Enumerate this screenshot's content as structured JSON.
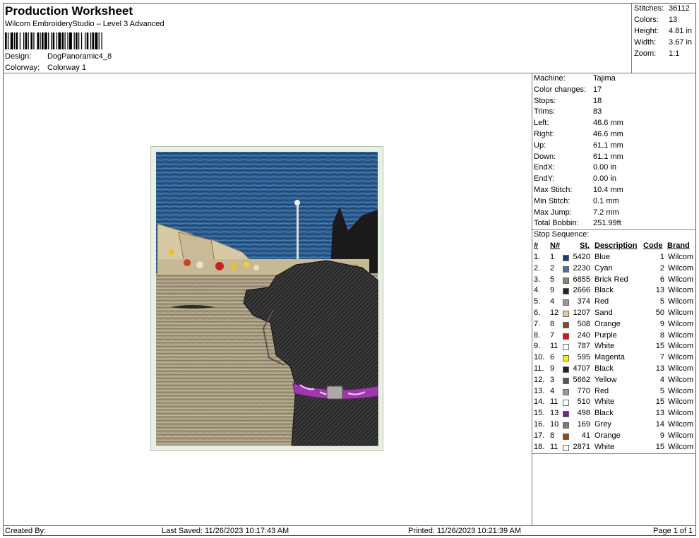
{
  "header": {
    "title": "Production Worksheet",
    "subtitle": "Wilcom EmbroideryStudio – Level 3 Advanced",
    "design_label": "Design:",
    "design_value": "DogPanoramic4_8",
    "colorway_label": "Colorway:",
    "colorway_value": "Colorway 1"
  },
  "stats": [
    {
      "label": "Stitches:",
      "value": "36112"
    },
    {
      "label": "Colors:",
      "value": "13"
    },
    {
      "label": "Height:",
      "value": "4.81 in"
    },
    {
      "label": "Width:",
      "value": "3.67 in"
    },
    {
      "label": "Zoom:",
      "value": "1:1"
    }
  ],
  "machine_info": [
    {
      "label": "Machine:",
      "value": "Tajima"
    },
    {
      "label": "Color changes:",
      "value": "17"
    },
    {
      "label": "Stops:",
      "value": "18"
    },
    {
      "label": "Trims:",
      "value": "83"
    },
    {
      "label": "Left:",
      "value": "46.6 mm"
    },
    {
      "label": "Right:",
      "value": "46.6 mm"
    },
    {
      "label": "Up:",
      "value": "61.1 mm"
    },
    {
      "label": "Down:",
      "value": "61.1 mm"
    },
    {
      "label": "EndX:",
      "value": "0.00 in"
    },
    {
      "label": "EndY:",
      "value": "0.00 in"
    },
    {
      "label": "Max Stitch:",
      "value": "10.4 mm"
    },
    {
      "label": "Min Stitch:",
      "value": "0.1 mm"
    },
    {
      "label": "Max Jump:",
      "value": "7.2 mm"
    },
    {
      "label": "Total Bobbin:",
      "value": "251.99ft"
    }
  ],
  "stop_sequence": {
    "label": "Stop Sequence:",
    "headers": {
      "num": "#",
      "n": "N#",
      "st": "St.",
      "desc": "Description",
      "code": "Code",
      "brand": "Brand"
    },
    "rows": [
      {
        "num": "1.",
        "n": "1",
        "color": "#1f3f70",
        "st": "5420",
        "desc": "Blue",
        "code": "1",
        "brand": "Wilcom"
      },
      {
        "num": "2.",
        "n": "2",
        "color": "#3f74b0",
        "st": "2230",
        "desc": "Cyan",
        "code": "2",
        "brand": "Wilcom"
      },
      {
        "num": "3.",
        "n": "5",
        "color": "#8c8270",
        "st": "6855",
        "desc": "Brick Red",
        "code": "6",
        "brand": "Wilcom"
      },
      {
        "num": "4.",
        "n": "9",
        "color": "#222222",
        "st": "2666",
        "desc": "Black",
        "code": "13",
        "brand": "Wilcom"
      },
      {
        "num": "5.",
        "n": "4",
        "color": "#9a9a9a",
        "st": "374",
        "desc": "Red",
        "code": "5",
        "brand": "Wilcom"
      },
      {
        "num": "6.",
        "n": "12",
        "color": "#f0c898",
        "st": "1207",
        "desc": "Sand",
        "code": "50",
        "brand": "Wilcom"
      },
      {
        "num": "7.",
        "n": "8",
        "color": "#8a4a18",
        "st": "508",
        "desc": "Orange",
        "code": "9",
        "brand": "Wilcom"
      },
      {
        "num": "8.",
        "n": "7",
        "color": "#e01010",
        "st": "240",
        "desc": "Purple",
        "code": "8",
        "brand": "Wilcom"
      },
      {
        "num": "9.",
        "n": "11",
        "color": "#ffffff",
        "st": "787",
        "desc": "White",
        "code": "15",
        "brand": "Wilcom"
      },
      {
        "num": "10.",
        "n": "6",
        "color": "#f4f010",
        "st": "595",
        "desc": "Magenta",
        "code": "7",
        "brand": "Wilcom"
      },
      {
        "num": "11.",
        "n": "9",
        "color": "#222222",
        "st": "4707",
        "desc": "Black",
        "code": "13",
        "brand": "Wilcom"
      },
      {
        "num": "12.",
        "n": "3",
        "color": "#555555",
        "st": "5662",
        "desc": "Yellow",
        "code": "4",
        "brand": "Wilcom"
      },
      {
        "num": "13.",
        "n": "4",
        "color": "#9a9a9a",
        "st": "770",
        "desc": "Red",
        "code": "5",
        "brand": "Wilcom"
      },
      {
        "num": "14.",
        "n": "11",
        "color": "#ffffff",
        "st": "510",
        "desc": "White",
        "code": "15",
        "brand": "Wilcom"
      },
      {
        "num": "15.",
        "n": "13",
        "color": "#7a1a9a",
        "st": "498",
        "desc": "Black",
        "code": "13",
        "brand": "Wilcom"
      },
      {
        "num": "16.",
        "n": "10",
        "color": "#7a7a7a",
        "st": "169",
        "desc": "Grey",
        "code": "14",
        "brand": "Wilcom"
      },
      {
        "num": "17.",
        "n": "8",
        "color": "#8a4a18",
        "st": "41",
        "desc": "Orange",
        "code": "9",
        "brand": "Wilcom"
      },
      {
        "num": "18.",
        "n": "11",
        "color": "#ffffff",
        "st": "2871",
        "desc": "White",
        "code": "15",
        "brand": "Wilcom"
      }
    ]
  },
  "footer": {
    "created_by": "Created By:",
    "last_saved": "Last Saved: 11/26/2023 10:17:43 AM",
    "printed": "Printed: 11/26/2023 10:21:39 AM",
    "page": "Page 1 of 1"
  }
}
